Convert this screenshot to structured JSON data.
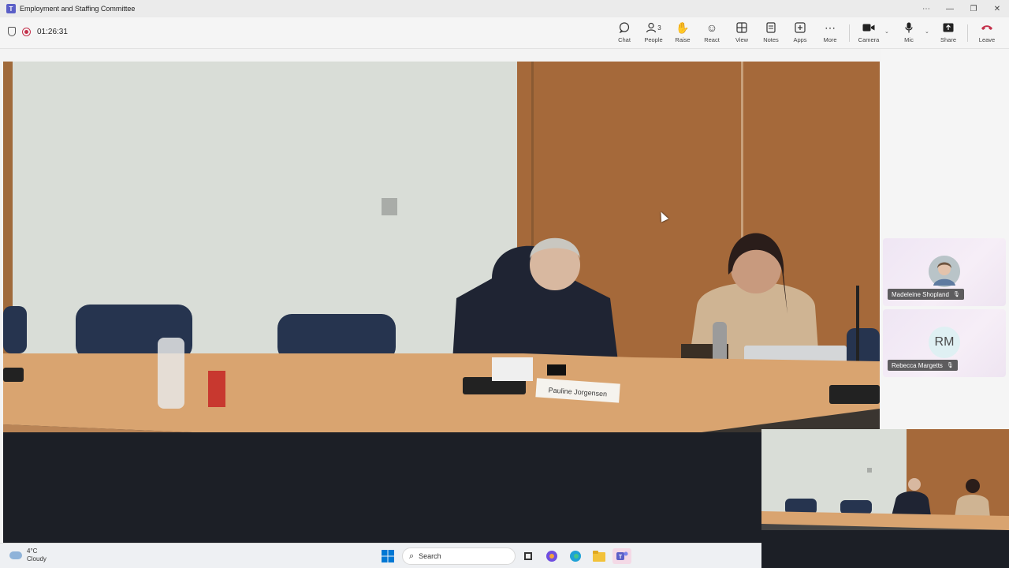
{
  "window": {
    "title": "Employment and Staffing Committee",
    "controls": [
      "⋯",
      "—",
      "❐",
      "✕"
    ]
  },
  "meeting": {
    "timer": "01:26:31"
  },
  "toolbar": {
    "chat": "Chat",
    "people": "People",
    "people_count": "3",
    "raise": "Raise",
    "react": "React",
    "view": "View",
    "notes": "Notes",
    "apps": "Apps",
    "more": "More",
    "camera": "Camera",
    "mic": "Mic",
    "share": "Share",
    "leave": "Leave"
  },
  "video": {
    "nameplate": "Pauline Jorgensen"
  },
  "participants": [
    {
      "name": "Madeleine Shopland",
      "initials": "",
      "muted": true
    },
    {
      "name": "Rebecca Margetts",
      "initials": "RM",
      "muted": true
    }
  ],
  "taskbar": {
    "temperature": "4°C",
    "condition": "Cloudy",
    "search_placeholder": "Search"
  },
  "colors": {
    "accent": "#5b5fc7",
    "leave": "#c4314b",
    "recording": "#c4314b"
  }
}
